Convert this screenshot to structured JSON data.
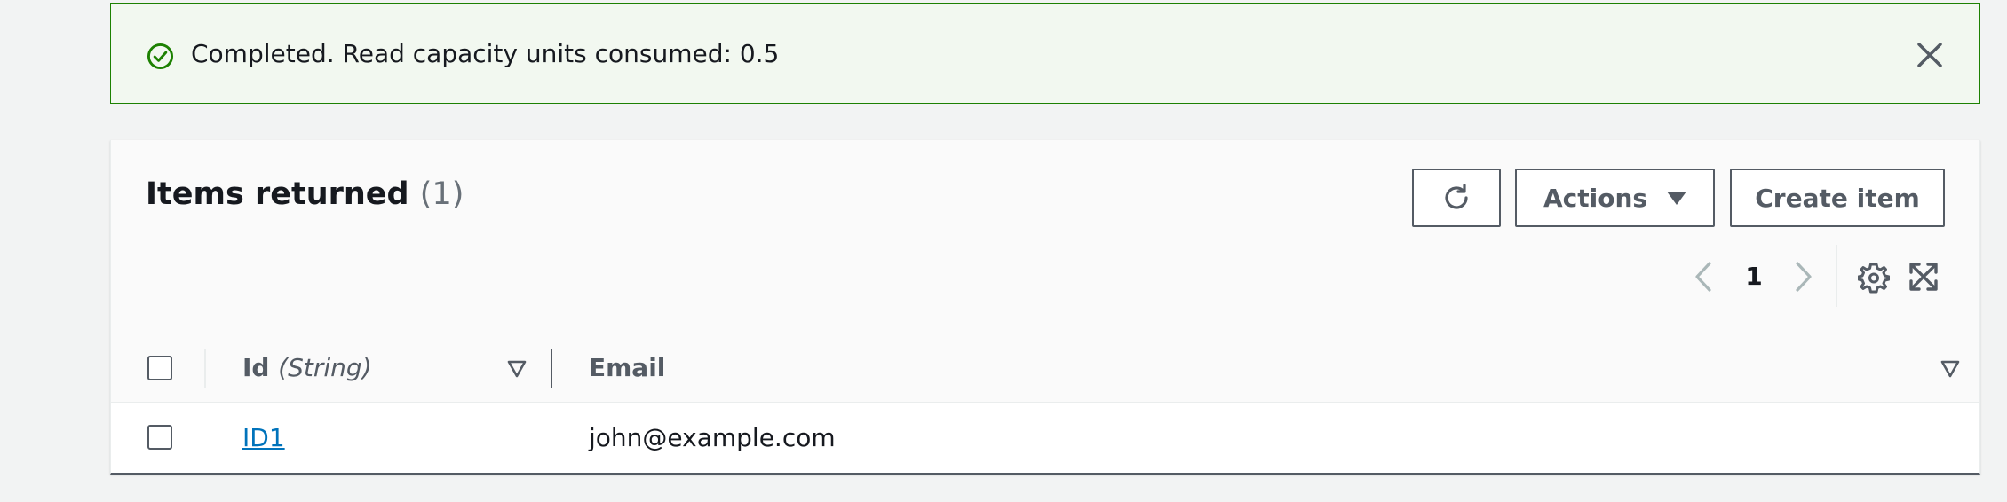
{
  "flash": {
    "message": "Completed. Read capacity units consumed: 0.5",
    "status": "success",
    "status_color": "#1d8102",
    "icon": "check-circle-icon",
    "dismiss_icon": "close-icon"
  },
  "items": {
    "title": "Items returned",
    "count": "(1)",
    "refresh_icon": "refresh-icon",
    "actions_label": "Actions",
    "actions_icon": "caret-down-icon",
    "create_label": "Create item"
  },
  "pagination": {
    "current_page": "1",
    "prev_icon": "chevron-left-icon",
    "next_icon": "chevron-right-icon",
    "preferences_icon": "gear-icon",
    "fullscreen_icon": "fullscreen-icon"
  },
  "table": {
    "columns": [
      {
        "name": "Id",
        "type": "(String)"
      },
      {
        "name": "Email",
        "type": ""
      }
    ],
    "rows": [
      {
        "id": "ID1",
        "email": "john@example.com",
        "selected": false
      }
    ]
  },
  "colors": {
    "link": "#0073bb",
    "button_border": "#545b64",
    "success": "#1d8102"
  }
}
